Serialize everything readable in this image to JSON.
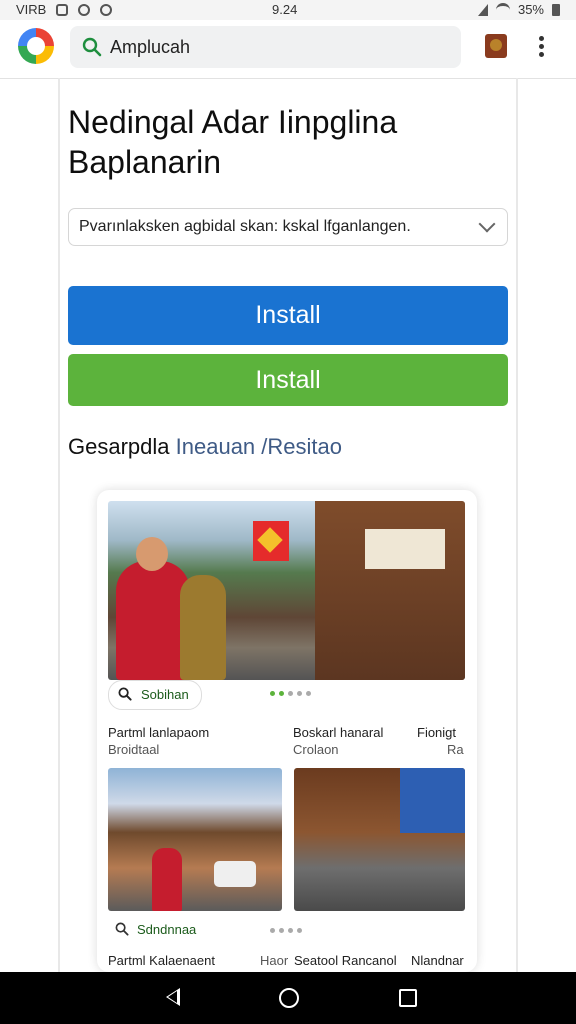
{
  "status_bar": {
    "carrier": "VIRB",
    "time": "9.24",
    "battery": "35%"
  },
  "browser": {
    "url_text": "Amplucah",
    "logo": "google-logo",
    "avatar_icon": "avatar-icon",
    "menu_icon": "vertical-dots-icon"
  },
  "page": {
    "title": "Nedingal Adar Iinpglina Baplanarin",
    "dropdown_value": "Pvarınlaksken agbidal skan: kskal lfganlangen.",
    "install_primary": "Install",
    "install_secondary": "Install",
    "section_heading_main": "Gesarpdla",
    "section_heading_accent": "Ineauan /Resitao"
  },
  "card": {
    "search_chip_label": "Sobihan",
    "row1_col1": "Partml lanlapaom",
    "row1_col2": "Boskarl hanaral",
    "row1_col3": "Fionigt",
    "row2_col1": "Broidtaal",
    "row2_col2": "Crolaon",
    "row2_col3": "Ra",
    "thumb_label": "Sdndnnaa",
    "footer_col1": "Partml Kalaenaent",
    "footer_col2": "Haor",
    "footer_col3": "Seatool Rancanol",
    "footer_col4": "Nlandnar"
  },
  "colors": {
    "primary_blue": "#1a73d1",
    "primary_green": "#5cb33c",
    "heading_accent": "#3f5b86"
  }
}
